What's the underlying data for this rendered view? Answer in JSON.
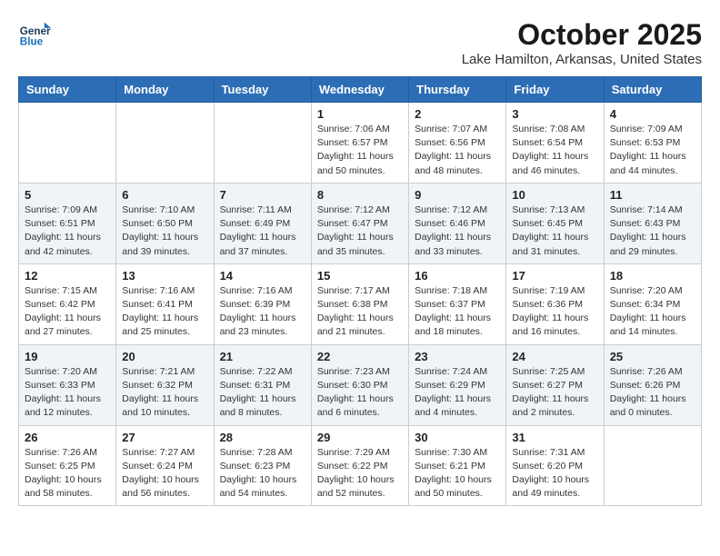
{
  "logo": {
    "line1": "General",
    "line2": "Blue"
  },
  "header": {
    "month": "October 2025",
    "location": "Lake Hamilton, Arkansas, United States"
  },
  "days_of_week": [
    "Sunday",
    "Monday",
    "Tuesday",
    "Wednesday",
    "Thursday",
    "Friday",
    "Saturday"
  ],
  "weeks": [
    [
      {
        "day": "",
        "info": ""
      },
      {
        "day": "",
        "info": ""
      },
      {
        "day": "",
        "info": ""
      },
      {
        "day": "1",
        "info": "Sunrise: 7:06 AM\nSunset: 6:57 PM\nDaylight: 11 hours\nand 50 minutes."
      },
      {
        "day": "2",
        "info": "Sunrise: 7:07 AM\nSunset: 6:56 PM\nDaylight: 11 hours\nand 48 minutes."
      },
      {
        "day": "3",
        "info": "Sunrise: 7:08 AM\nSunset: 6:54 PM\nDaylight: 11 hours\nand 46 minutes."
      },
      {
        "day": "4",
        "info": "Sunrise: 7:09 AM\nSunset: 6:53 PM\nDaylight: 11 hours\nand 44 minutes."
      }
    ],
    [
      {
        "day": "5",
        "info": "Sunrise: 7:09 AM\nSunset: 6:51 PM\nDaylight: 11 hours\nand 42 minutes."
      },
      {
        "day": "6",
        "info": "Sunrise: 7:10 AM\nSunset: 6:50 PM\nDaylight: 11 hours\nand 39 minutes."
      },
      {
        "day": "7",
        "info": "Sunrise: 7:11 AM\nSunset: 6:49 PM\nDaylight: 11 hours\nand 37 minutes."
      },
      {
        "day": "8",
        "info": "Sunrise: 7:12 AM\nSunset: 6:47 PM\nDaylight: 11 hours\nand 35 minutes."
      },
      {
        "day": "9",
        "info": "Sunrise: 7:12 AM\nSunset: 6:46 PM\nDaylight: 11 hours\nand 33 minutes."
      },
      {
        "day": "10",
        "info": "Sunrise: 7:13 AM\nSunset: 6:45 PM\nDaylight: 11 hours\nand 31 minutes."
      },
      {
        "day": "11",
        "info": "Sunrise: 7:14 AM\nSunset: 6:43 PM\nDaylight: 11 hours\nand 29 minutes."
      }
    ],
    [
      {
        "day": "12",
        "info": "Sunrise: 7:15 AM\nSunset: 6:42 PM\nDaylight: 11 hours\nand 27 minutes."
      },
      {
        "day": "13",
        "info": "Sunrise: 7:16 AM\nSunset: 6:41 PM\nDaylight: 11 hours\nand 25 minutes."
      },
      {
        "day": "14",
        "info": "Sunrise: 7:16 AM\nSunset: 6:39 PM\nDaylight: 11 hours\nand 23 minutes."
      },
      {
        "day": "15",
        "info": "Sunrise: 7:17 AM\nSunset: 6:38 PM\nDaylight: 11 hours\nand 21 minutes."
      },
      {
        "day": "16",
        "info": "Sunrise: 7:18 AM\nSunset: 6:37 PM\nDaylight: 11 hours\nand 18 minutes."
      },
      {
        "day": "17",
        "info": "Sunrise: 7:19 AM\nSunset: 6:36 PM\nDaylight: 11 hours\nand 16 minutes."
      },
      {
        "day": "18",
        "info": "Sunrise: 7:20 AM\nSunset: 6:34 PM\nDaylight: 11 hours\nand 14 minutes."
      }
    ],
    [
      {
        "day": "19",
        "info": "Sunrise: 7:20 AM\nSunset: 6:33 PM\nDaylight: 11 hours\nand 12 minutes."
      },
      {
        "day": "20",
        "info": "Sunrise: 7:21 AM\nSunset: 6:32 PM\nDaylight: 11 hours\nand 10 minutes."
      },
      {
        "day": "21",
        "info": "Sunrise: 7:22 AM\nSunset: 6:31 PM\nDaylight: 11 hours\nand 8 minutes."
      },
      {
        "day": "22",
        "info": "Sunrise: 7:23 AM\nSunset: 6:30 PM\nDaylight: 11 hours\nand 6 minutes."
      },
      {
        "day": "23",
        "info": "Sunrise: 7:24 AM\nSunset: 6:29 PM\nDaylight: 11 hours\nand 4 minutes."
      },
      {
        "day": "24",
        "info": "Sunrise: 7:25 AM\nSunset: 6:27 PM\nDaylight: 11 hours\nand 2 minutes."
      },
      {
        "day": "25",
        "info": "Sunrise: 7:26 AM\nSunset: 6:26 PM\nDaylight: 11 hours\nand 0 minutes."
      }
    ],
    [
      {
        "day": "26",
        "info": "Sunrise: 7:26 AM\nSunset: 6:25 PM\nDaylight: 10 hours\nand 58 minutes."
      },
      {
        "day": "27",
        "info": "Sunrise: 7:27 AM\nSunset: 6:24 PM\nDaylight: 10 hours\nand 56 minutes."
      },
      {
        "day": "28",
        "info": "Sunrise: 7:28 AM\nSunset: 6:23 PM\nDaylight: 10 hours\nand 54 minutes."
      },
      {
        "day": "29",
        "info": "Sunrise: 7:29 AM\nSunset: 6:22 PM\nDaylight: 10 hours\nand 52 minutes."
      },
      {
        "day": "30",
        "info": "Sunrise: 7:30 AM\nSunset: 6:21 PM\nDaylight: 10 hours\nand 50 minutes."
      },
      {
        "day": "31",
        "info": "Sunrise: 7:31 AM\nSunset: 6:20 PM\nDaylight: 10 hours\nand 49 minutes."
      },
      {
        "day": "",
        "info": ""
      }
    ]
  ]
}
